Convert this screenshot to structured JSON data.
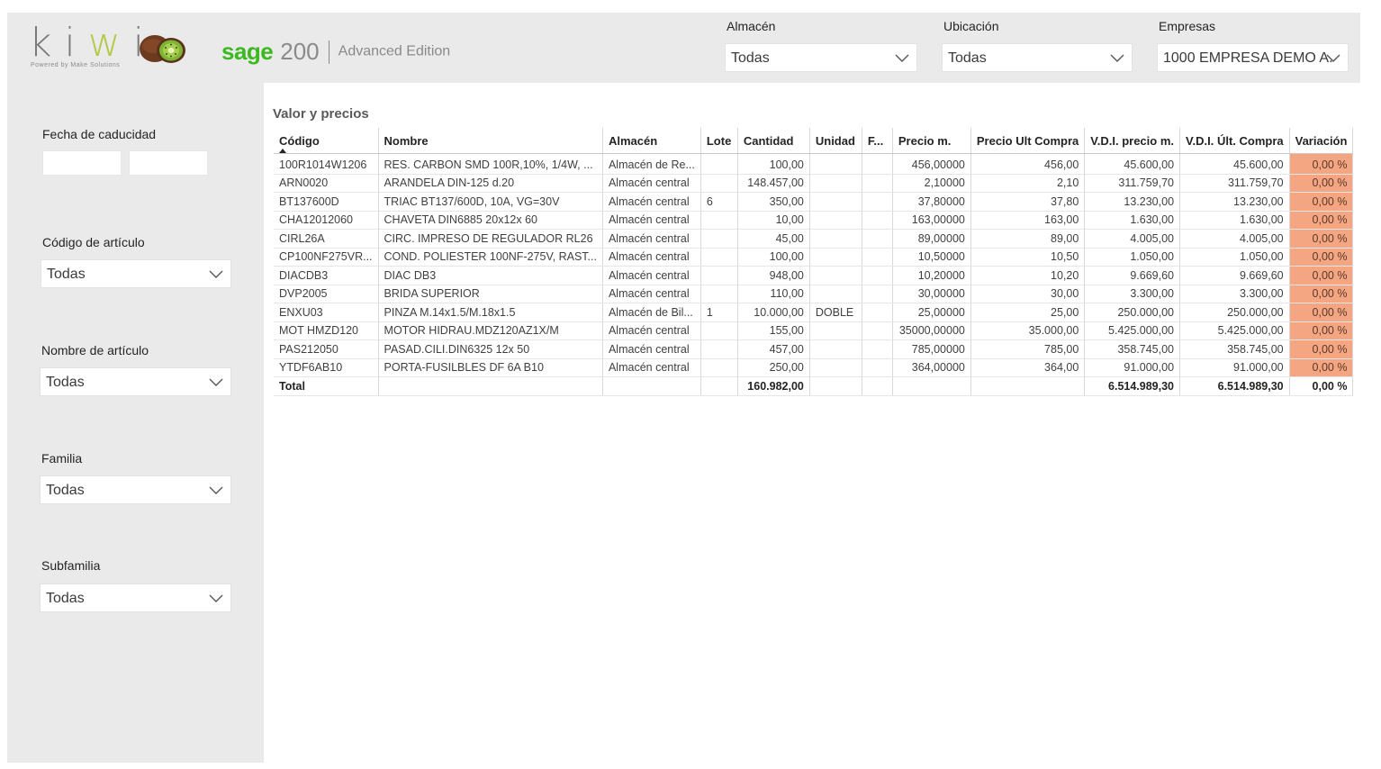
{
  "branding": {
    "kiwi_text_a": "ki",
    "kiwi_text_w": "w",
    "kiwi_text_b": "i",
    "kiwi_subtitle": "Powered by Make Solutions",
    "sage_word": "sage",
    "sage_number": "200",
    "sage_edition": "Advanced Edition"
  },
  "top_filters": {
    "almacen": {
      "label": "Almacén",
      "value": "Todas"
    },
    "ubicacion": {
      "label": "Ubicación",
      "value": "Todas"
    },
    "empresas": {
      "label": "Empresas",
      "value": "1000 EMPRESA DEMO A..."
    }
  },
  "side_filters": {
    "fecha": {
      "label": "Fecha de caducidad",
      "from": "",
      "to": ""
    },
    "codigo": {
      "label": "Código de artículo",
      "value": "Todas"
    },
    "nombre": {
      "label": "Nombre de artículo",
      "value": "Todas"
    },
    "familia": {
      "label": "Familia",
      "value": "Todas"
    },
    "subfamilia": {
      "label": "Subfamilia",
      "value": "Todas"
    }
  },
  "table": {
    "title": "Valor y precios",
    "headers": [
      "Código",
      "Nombre",
      "Almacén",
      "Lote",
      "Cantidad",
      "Unidad",
      "F...",
      "Precio m.",
      "Precio Ult Compra",
      "V.D.I. precio m.",
      "V.D.I. Últ. Compra",
      "Variación"
    ],
    "rows": [
      [
        "100R1014W1206",
        "RES. CARBON SMD 100R,10%, 1/4W, ...",
        "Almacén de Re...",
        "",
        "100,00",
        "",
        "",
        "456,00000",
        "456,00",
        "45.600,00",
        "45.600,00",
        "0,00 %"
      ],
      [
        "ARN0020",
        "ARANDELA DIN-125 d.20",
        "Almacén central",
        "",
        "148.457,00",
        "",
        "",
        "2,10000",
        "2,10",
        "311.759,70",
        "311.759,70",
        "0,00 %"
      ],
      [
        "BT137600D",
        "TRIAC BT137/600D, 10A, VG=30V",
        "Almacén central",
        "6",
        "350,00",
        "",
        "",
        "37,80000",
        "37,80",
        "13.230,00",
        "13.230,00",
        "0,00 %"
      ],
      [
        "CHA12012060",
        "CHAVETA DIN6885 20x12x 60",
        "Almacén central",
        "",
        "10,00",
        "",
        "",
        "163,00000",
        "163,00",
        "1.630,00",
        "1.630,00",
        "0,00 %"
      ],
      [
        "CIRL26A",
        "CIRC. IMPRESO DE REGULADOR RL26",
        "Almacén central",
        "",
        "45,00",
        "",
        "",
        "89,00000",
        "89,00",
        "4.005,00",
        "4.005,00",
        "0,00 %"
      ],
      [
        "CP100NF275VR...",
        "COND. POLIESTER 100NF-275V, RAST...",
        "Almacén central",
        "",
        "100,00",
        "",
        "",
        "10,50000",
        "10,50",
        "1.050,00",
        "1.050,00",
        "0,00 %"
      ],
      [
        "DIACDB3",
        "DIAC DB3",
        "Almacén central",
        "",
        "948,00",
        "",
        "",
        "10,20000",
        "10,20",
        "9.669,60",
        "9.669,60",
        "0,00 %"
      ],
      [
        "DVP2005",
        "BRIDA SUPERIOR",
        "Almacén central",
        "",
        "110,00",
        "",
        "",
        "30,00000",
        "30,00",
        "3.300,00",
        "3.300,00",
        "0,00 %"
      ],
      [
        "ENXU03",
        "PINZA M.14x1.5/M.18x1.5",
        "Almacén de Bil...",
        "1",
        "10.000,00",
        "DOBLE",
        "",
        "25,00000",
        "25,00",
        "250.000,00",
        "250.000,00",
        "0,00 %"
      ],
      [
        "MOT HMZD120",
        "MOTOR HIDRAU.MDZ120AZ1X/M",
        "Almacén central",
        "",
        "155,00",
        "",
        "",
        "35000,00000",
        "35.000,00",
        "5.425.000,00",
        "5.425.000,00",
        "0,00 %"
      ],
      [
        "PAS212050",
        "PASAD.CILI.DIN6325 12x 50",
        "Almacén central",
        "",
        "457,00",
        "",
        "",
        "785,00000",
        "785,00",
        "358.745,00",
        "358.745,00",
        "0,00 %"
      ],
      [
        "YTDF6AB10",
        "PORTA-FUSILBLES DF 6A B10",
        "Almacén central",
        "",
        "250,00",
        "",
        "",
        "364,00000",
        "364,00",
        "91.000,00",
        "91.000,00",
        "0,00 %"
      ]
    ],
    "total": [
      "Total",
      "",
      "",
      "",
      "160.982,00",
      "",
      "",
      "",
      "",
      "6.514.989,30",
      "6.514.989,30",
      "0,00 %"
    ]
  },
  "colors": {
    "panel_bg": "#eaeaea",
    "variation_cell": "#f4a683",
    "sage_green": "#3cb820",
    "kiwi_green": "#b3c94a"
  }
}
